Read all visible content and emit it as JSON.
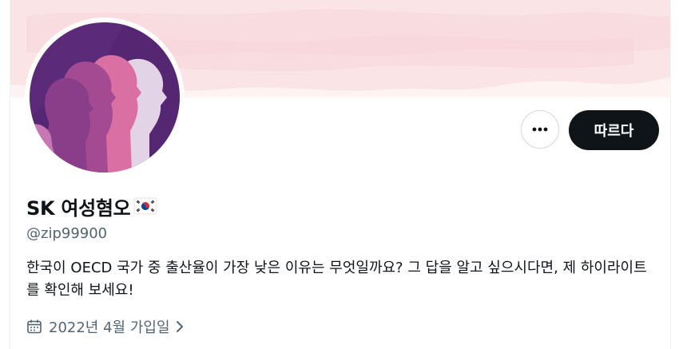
{
  "profile": {
    "display_name": "SK 여성혐오",
    "flag_icon": "south-korea-flag-icon",
    "handle": "@zip99900",
    "bio": "한국이 OECD 국가 중 출산율이 가장 낮은 이유는 무엇일까요? 그 답을 알고 싶으시다면, 제 하이라이트를 확인해 보세요!",
    "joined": "2022년 4월 가입일"
  },
  "actions": {
    "more_icon": "more-horizontal-icon",
    "follow_label": "따르다"
  },
  "icons": {
    "calendar": "calendar-icon",
    "chevron": "chevron-right-icon"
  },
  "colors": {
    "primary_text": "#0f1419",
    "secondary_text": "#536471",
    "follow_button_bg": "#0f1419",
    "avatar_bg": "#5b2a79",
    "banner_bg": "#fbe6e8"
  }
}
